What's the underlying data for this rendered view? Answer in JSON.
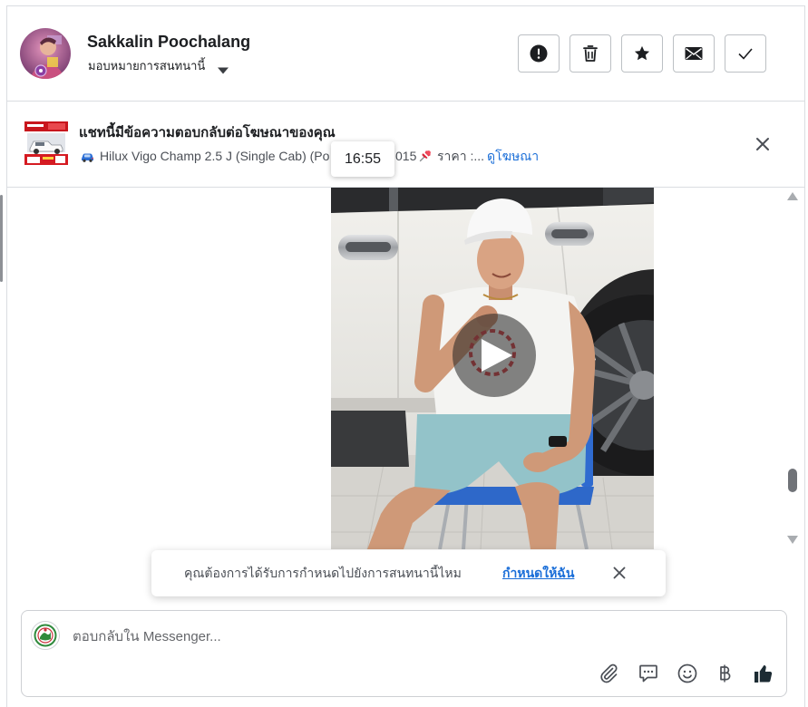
{
  "header": {
    "contact_name": "Sakkalin Poochalang",
    "assign_label": "มอบหมายการสนทนานี้",
    "action_icons": [
      "exclamation-circle-icon",
      "trash-icon",
      "star-icon",
      "envelope-icon",
      "check-icon"
    ]
  },
  "ad_banner": {
    "title": "แชทนี้มีข้อความตอบกลับต่อโฆษณาของคุณ",
    "vehicle_text": "Hilux Vigo Champ 2.5 J (Single Cab) (Po",
    "vehicle_text_tail": "015",
    "price_text": "ราคา :...",
    "link_label": "ดูโฆษณา",
    "icons": [
      "car-emoji-icon",
      "pushpin-icon",
      "close-icon"
    ]
  },
  "timestamp_tooltip": "16:55",
  "video_message": {
    "icon": "play-icon"
  },
  "assign_prompt": {
    "text": "คุณต้องการได้รับการกำหนดไปยังการสนทนานี้ไหม",
    "link_label": "กำหนดให้ฉัน",
    "close_icon": "close-icon"
  },
  "composer": {
    "placeholder": "ตอบกลับใน Messenger...",
    "icons": [
      "paperclip-icon",
      "chat-bubble-icon",
      "emoji-icon",
      "baht-icon",
      "thumbs-up-icon"
    ]
  },
  "colors": {
    "text_primary": "#1c1e21",
    "text_secondary": "#4b4f56",
    "link": "#1a6ed8",
    "border": "#dadde1"
  }
}
